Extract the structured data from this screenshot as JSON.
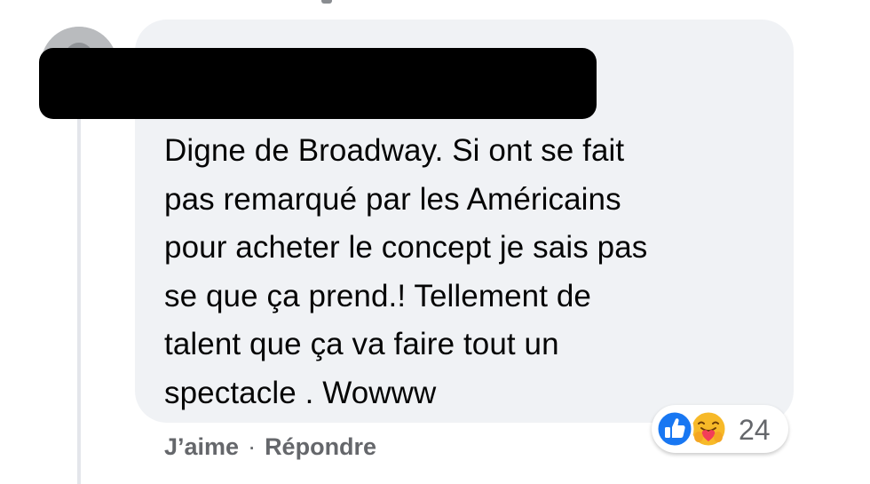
{
  "comment": {
    "text_lines": [
      "Digne de Broadway. Si ont se fait",
      "pas remarqué par les Américains",
      "pour acheter le concept je sais pas",
      "se que ça prend.! Tellement de",
      "talent que ça va faire tout un",
      "spectacle . Wowww"
    ]
  },
  "actions": {
    "like_label": "J’aime",
    "separator": "·",
    "reply_label": "Répondre"
  },
  "reactions": {
    "icons": [
      "like-icon",
      "care-icon"
    ],
    "count": "24"
  },
  "colors": {
    "bubble": "#f0f2f5",
    "like_blue": "#1877f2",
    "secondary_text": "#65676b",
    "care_yellow": "#f7b928",
    "care_red": "#f33e58"
  }
}
